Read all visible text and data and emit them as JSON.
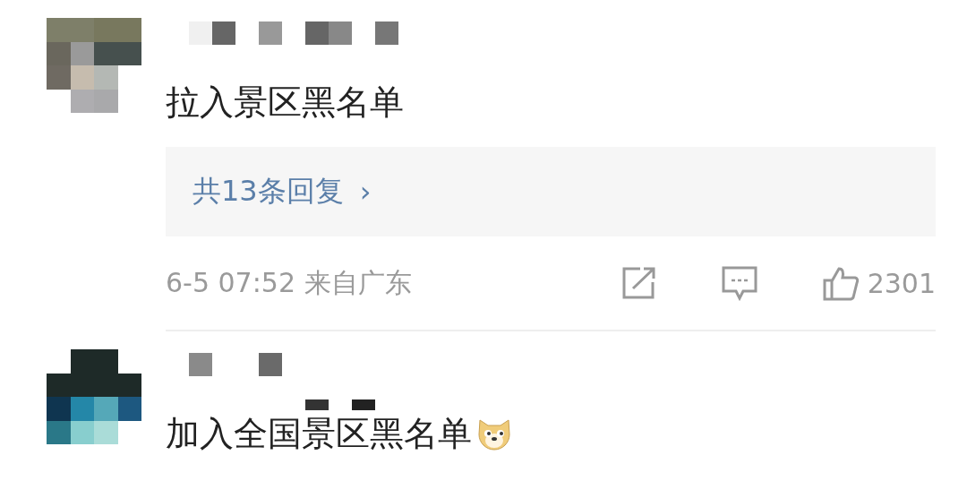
{
  "comments": [
    {
      "text": "拉入景区黑名单",
      "replies": {
        "label": "共13条回复",
        "arrow": "›"
      },
      "footer": {
        "time": "6-5 07:52 来自广东",
        "likes": "2301"
      }
    },
    {
      "text": "加入全国景区黑名单",
      "emoji": true
    }
  ]
}
